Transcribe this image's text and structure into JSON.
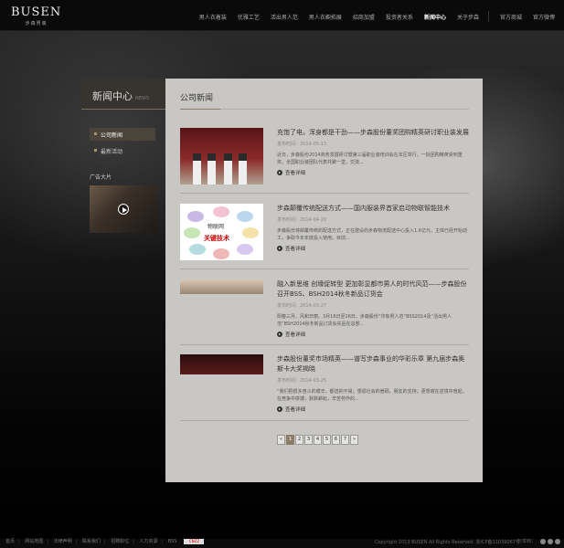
{
  "logo": {
    "brand": "BUSEN",
    "sub": "步森男装"
  },
  "nav": [
    {
      "label": "男人衣着装",
      "active": false
    },
    {
      "label": "优雅工艺",
      "active": false
    },
    {
      "label": "活出男人范",
      "active": false
    },
    {
      "label": "男人衣橱拓展",
      "active": false
    },
    {
      "label": "招商加盟",
      "active": false
    },
    {
      "label": "投资者关系",
      "active": false
    },
    {
      "label": "新闻中心",
      "active": true
    },
    {
      "label": "关于步森",
      "active": false
    },
    {
      "label": "官方商城",
      "active": false
    },
    {
      "label": "官方微博",
      "active": false
    }
  ],
  "sidebar": {
    "title_zh": "新闻中心",
    "title_en": "NEWS",
    "items": [
      {
        "label": "公司新闻",
        "active": true
      },
      {
        "label": "最新活动",
        "active": false
      }
    ],
    "ad_label": "广告大片"
  },
  "main": {
    "title": "公司新闻",
    "news": [
      {
        "title": "充饱了电，浑身都是干劲——步森股份董奖团购精英研讨职业装发展",
        "date": "发布时间：2014-05-13",
        "desc": "近日，步森股份2014商务发展研讨暨第三届职业装培训会在本区举行，一批团购精英受到重奖。全国职业装团队代表共聚一堂，交流...",
        "more": "查看详细"
      },
      {
        "title": "步森颠覆传统配送方式——国内服装界首家启动物联智能技术",
        "date": "发布时间：2014-04-20",
        "desc": "步森股份将颠覆传统的配送方式，正在建设的步森物流配送中心投入1.6亿元，主体已经开始动工，争取今年年底投入使用。目前...",
        "more": "查看详细"
      },
      {
        "title": "融入新思维 创壕促转型 更加彰显都市男人的时代风范——步森股份召开BSS、BSH2014秋冬新品订货会",
        "date": "发布时间：2014-03-27",
        "desc": "阳春三月，风和日丽。3月16日至26日，步森股份“印象男人范”BSS2014及“活出男人范”BSH2014秋冬新品订货会先后在总部...",
        "more": "查看详细"
      },
      {
        "title": "步森股份董奖市场精英——谱写步森事业的华彩乐章 第九届步森奥斯卡大奖揭晓",
        "date": "发布时间：2014-03-25",
        "desc": "“我们把很多奋斗的艰辛，都送的不易；感恩社会的眷顾，朋友的支持；更想谢在逆境中奋起，在竞争中拼搏，默默耕耘，辛苦劳作的...",
        "more": "查看详细"
      }
    ],
    "pager": [
      "«",
      "1",
      "2",
      "3",
      "4",
      "5",
      "6",
      "7",
      "»"
    ],
    "current_page": "1",
    "thumb2_words": [
      "物联网",
      "关键技术"
    ]
  },
  "footer": {
    "links": [
      "首页",
      "网站地图",
      "法律声明",
      "联系我们",
      "招聘职位",
      "人力资源",
      "BSS"
    ],
    "cnzz": "CNZZ",
    "copyright": "Copyright 2013 BUSEN All Rights Reserved. 浙ICP备11039067号",
    "share_label": "分享到："
  },
  "colors": {
    "panel": "#c9c7c3",
    "accent": "#8b7d69",
    "page_bg": "#0b0b0b"
  }
}
